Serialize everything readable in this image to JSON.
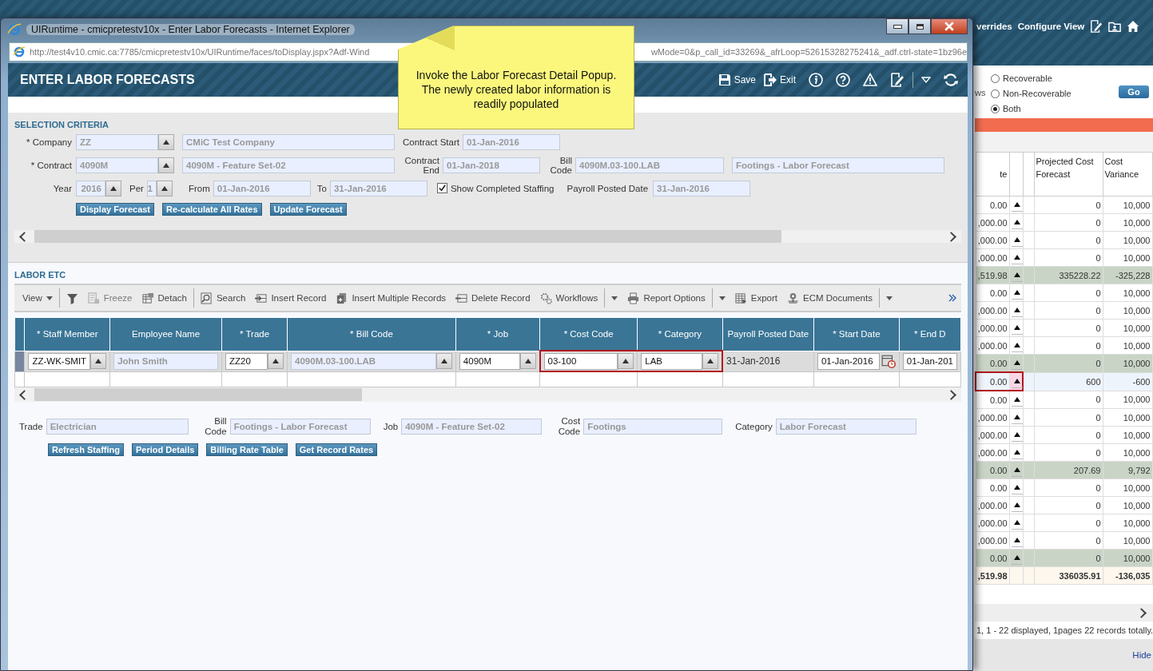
{
  "background": {
    "header_links": [
      "verrides",
      "Configure View"
    ],
    "filter_label": "ws",
    "radios": [
      {
        "label": "Recoverable",
        "selected": false
      },
      {
        "label": "Non-Recoverable",
        "selected": false
      },
      {
        "label": "Both",
        "selected": true
      }
    ],
    "go": "Go",
    "columns": [
      "te",
      "Projected Cost Forecast",
      "Cost Variance"
    ],
    "rows": [
      {
        "amount": "0.00",
        "forecast": "0",
        "variance": "10,000",
        "kind": "detail",
        "selected": false
      },
      {
        "amount": ",000.00",
        "forecast": "0",
        "variance": "10,000",
        "kind": "detail",
        "selected": false
      },
      {
        "amount": ",000.00",
        "forecast": "0",
        "variance": "10,000",
        "kind": "detail",
        "selected": false
      },
      {
        "amount": ",000.00",
        "forecast": "0",
        "variance": "10,000",
        "kind": "detail",
        "selected": false
      },
      {
        "amount": ",519.98",
        "forecast": "335228.22",
        "variance": "-325,228",
        "kind": "group",
        "selected": false
      },
      {
        "amount": "0.00",
        "forecast": "0",
        "variance": "10,000",
        "kind": "detail",
        "selected": false
      },
      {
        "amount": ",000.00",
        "forecast": "0",
        "variance": "10,000",
        "kind": "detail",
        "selected": false
      },
      {
        "amount": ",000.00",
        "forecast": "0",
        "variance": "10,000",
        "kind": "detail",
        "selected": false
      },
      {
        "amount": ",000.00",
        "forecast": "0",
        "variance": "10,000",
        "kind": "detail",
        "selected": false
      },
      {
        "amount": "0.00",
        "forecast": "0",
        "variance": "10,000",
        "kind": "group",
        "selected": false
      },
      {
        "amount": "0.00",
        "forecast": "600",
        "variance": "-600",
        "kind": "detail",
        "selected": true
      },
      {
        "amount": "0.00",
        "forecast": "0",
        "variance": "10,000",
        "kind": "detail",
        "selected": false
      },
      {
        "amount": ",000.00",
        "forecast": "0",
        "variance": "10,000",
        "kind": "detail",
        "selected": false
      },
      {
        "amount": ",000.00",
        "forecast": "0",
        "variance": "10,000",
        "kind": "detail",
        "selected": false
      },
      {
        "amount": ",000.00",
        "forecast": "0",
        "variance": "10,000",
        "kind": "detail",
        "selected": false
      },
      {
        "amount": "0.00",
        "forecast": "207.69",
        "variance": "9,792",
        "kind": "group",
        "selected": false
      },
      {
        "amount": "0.00",
        "forecast": "0",
        "variance": "10,000",
        "kind": "detail",
        "selected": false
      },
      {
        "amount": ",000.00",
        "forecast": "0",
        "variance": "10,000",
        "kind": "detail",
        "selected": false
      },
      {
        "amount": ",000.00",
        "forecast": "0",
        "variance": "10,000",
        "kind": "detail",
        "selected": false
      },
      {
        "amount": ",000.00",
        "forecast": "0",
        "variance": "10,000",
        "kind": "detail",
        "selected": false
      },
      {
        "amount": "0.00",
        "forecast": "0",
        "variance": "10,000",
        "kind": "group",
        "selected": false
      },
      {
        "amount": ",519.98",
        "forecast": "336035.91",
        "variance": "-136,035",
        "kind": "total",
        "selected": false
      }
    ],
    "status": "1, 1 - 22 displayed, 1pages 22 records totally.",
    "hide": "Hide"
  },
  "browser": {
    "title": "UIRuntime - cmicpretestv10x - Enter Labor Forecasts - Internet Explorer",
    "url_start": "http://test4v10.cmic.ca:7785/cmicpretestv10x/UIRuntime/faces/toDisplay.jspx?Adf-Wind",
    "url_end": "wMode=0&p_call_id=33269&_afrLoop=52615328275241&_adf.ctrl-state=1bz96e"
  },
  "note": "Invoke the Labor Forecast Detail Popup. The newly created labor information is readily populated",
  "page": {
    "title": "ENTER LABOR FORECASTS",
    "save": "Save",
    "exit": "Exit"
  },
  "selection": {
    "title": "SELECTION CRITERIA",
    "company": {
      "label": "* Company",
      "code": "ZZ",
      "name": "CMiC Test Company"
    },
    "contract_start": {
      "label": "Contract Start",
      "value": "01-Jan-2016"
    },
    "contract": {
      "label": "* Contract",
      "code": "4090M",
      "name": "4090M - Feature Set-02"
    },
    "contract_end": {
      "label": "Contract End",
      "value": "01-Jan-2018"
    },
    "bill_code": {
      "label": "Bill Code",
      "code": "4090M.03-100.LAB",
      "name": "Footings - Labor Forecast"
    },
    "year": {
      "label": "Year",
      "value": "2016"
    },
    "per": {
      "label": "Per",
      "value": "1"
    },
    "from": {
      "label": "From",
      "value": "01-Jan-2016"
    },
    "to": {
      "label": "To",
      "value": "31-Jan-2016"
    },
    "show_completed": {
      "label": "Show Completed Staffing",
      "checked": true
    },
    "payroll_posted": {
      "label": "Payroll Posted Date",
      "value": "31-Jan-2016"
    },
    "buttons": [
      "Display Forecast",
      "Re-calculate All Rates",
      "Update Forecast"
    ]
  },
  "labor": {
    "title": "LABOR ETC",
    "toolbar": [
      {
        "kind": "view",
        "label": "View",
        "separator": false,
        "disabled": false
      },
      {
        "kind": "filter",
        "separator": true,
        "disabled": false
      },
      {
        "kind": "freeze",
        "label": "Freeze",
        "separator": false,
        "disabled": true
      },
      {
        "kind": "detach",
        "label": "Detach",
        "separator": false,
        "disabled": false
      },
      {
        "kind": "search",
        "label": "Search",
        "separator": true,
        "disabled": false
      },
      {
        "kind": "insert",
        "label": "Insert Record",
        "separator": false,
        "disabled": false
      },
      {
        "kind": "insert-multiple",
        "label": "Insert Multiple Records",
        "separator": false,
        "disabled": false
      },
      {
        "kind": "delete",
        "label": "Delete Record",
        "separator": false,
        "disabled": false
      },
      {
        "kind": "workflows",
        "label": "Workflows",
        "separator": false,
        "disabled": false
      },
      {
        "kind": "dropdown",
        "separator": true,
        "disabled": false
      },
      {
        "kind": "report",
        "label": "Report Options",
        "separator": false,
        "disabled": false
      },
      {
        "kind": "dropdown",
        "separator": true,
        "disabled": false
      },
      {
        "kind": "export",
        "label": "Export",
        "separator": false,
        "disabled": false
      },
      {
        "kind": "ecm",
        "label": "ECM Documents",
        "separator": false,
        "disabled": false
      },
      {
        "kind": "dropdown",
        "separator": true,
        "disabled": false
      }
    ],
    "columns": [
      "* Staff Member",
      "Employee Name",
      "* Trade",
      "* Bill Code",
      "* Job",
      "* Cost Code",
      "* Category",
      "Payroll Posted Date",
      "* Start Date",
      "* End D"
    ],
    "row": [
      {
        "kind": "lookup",
        "value": "ZZ-WK-SMIT",
        "disabled": false,
        "highlighted": false
      },
      {
        "kind": "field",
        "value": "John Smith",
        "disabled": true,
        "highlighted": false
      },
      {
        "kind": "lookup",
        "value": "ZZ20",
        "disabled": false,
        "highlighted": false
      },
      {
        "kind": "lookup",
        "value": "4090M.03-100.LAB",
        "disabled": true,
        "highlighted": false
      },
      {
        "kind": "lookup",
        "value": "4090M",
        "disabled": false,
        "highlighted": false
      },
      {
        "kind": "lookup",
        "value": "03-100",
        "disabled": false,
        "highlighted": true
      },
      {
        "kind": "lookup",
        "value": "LAB",
        "disabled": false,
        "highlighted": true
      },
      {
        "kind": "plain",
        "value": "31-Jan-2016",
        "highlighted": false
      },
      {
        "kind": "date",
        "value": "01-Jan-2016",
        "disabled": false,
        "highlighted": false
      },
      {
        "kind": "field",
        "value": "01-Jan-201",
        "disabled": false,
        "highlighted": false
      }
    ],
    "details": [
      {
        "label": "Trade",
        "value": "Electrician"
      },
      {
        "label": "Bill Code",
        "value": "Footings - Labor Forecast"
      },
      {
        "label": "Job",
        "value": "4090M - Feature Set-02"
      },
      {
        "label": "Cost Code",
        "value": "Footings"
      },
      {
        "label": "Category",
        "value": "Labor Forecast"
      }
    ],
    "buttons": [
      "Refresh Staffing",
      "Period Details",
      "Billing Rate Table",
      "Get Record Rates"
    ]
  }
}
